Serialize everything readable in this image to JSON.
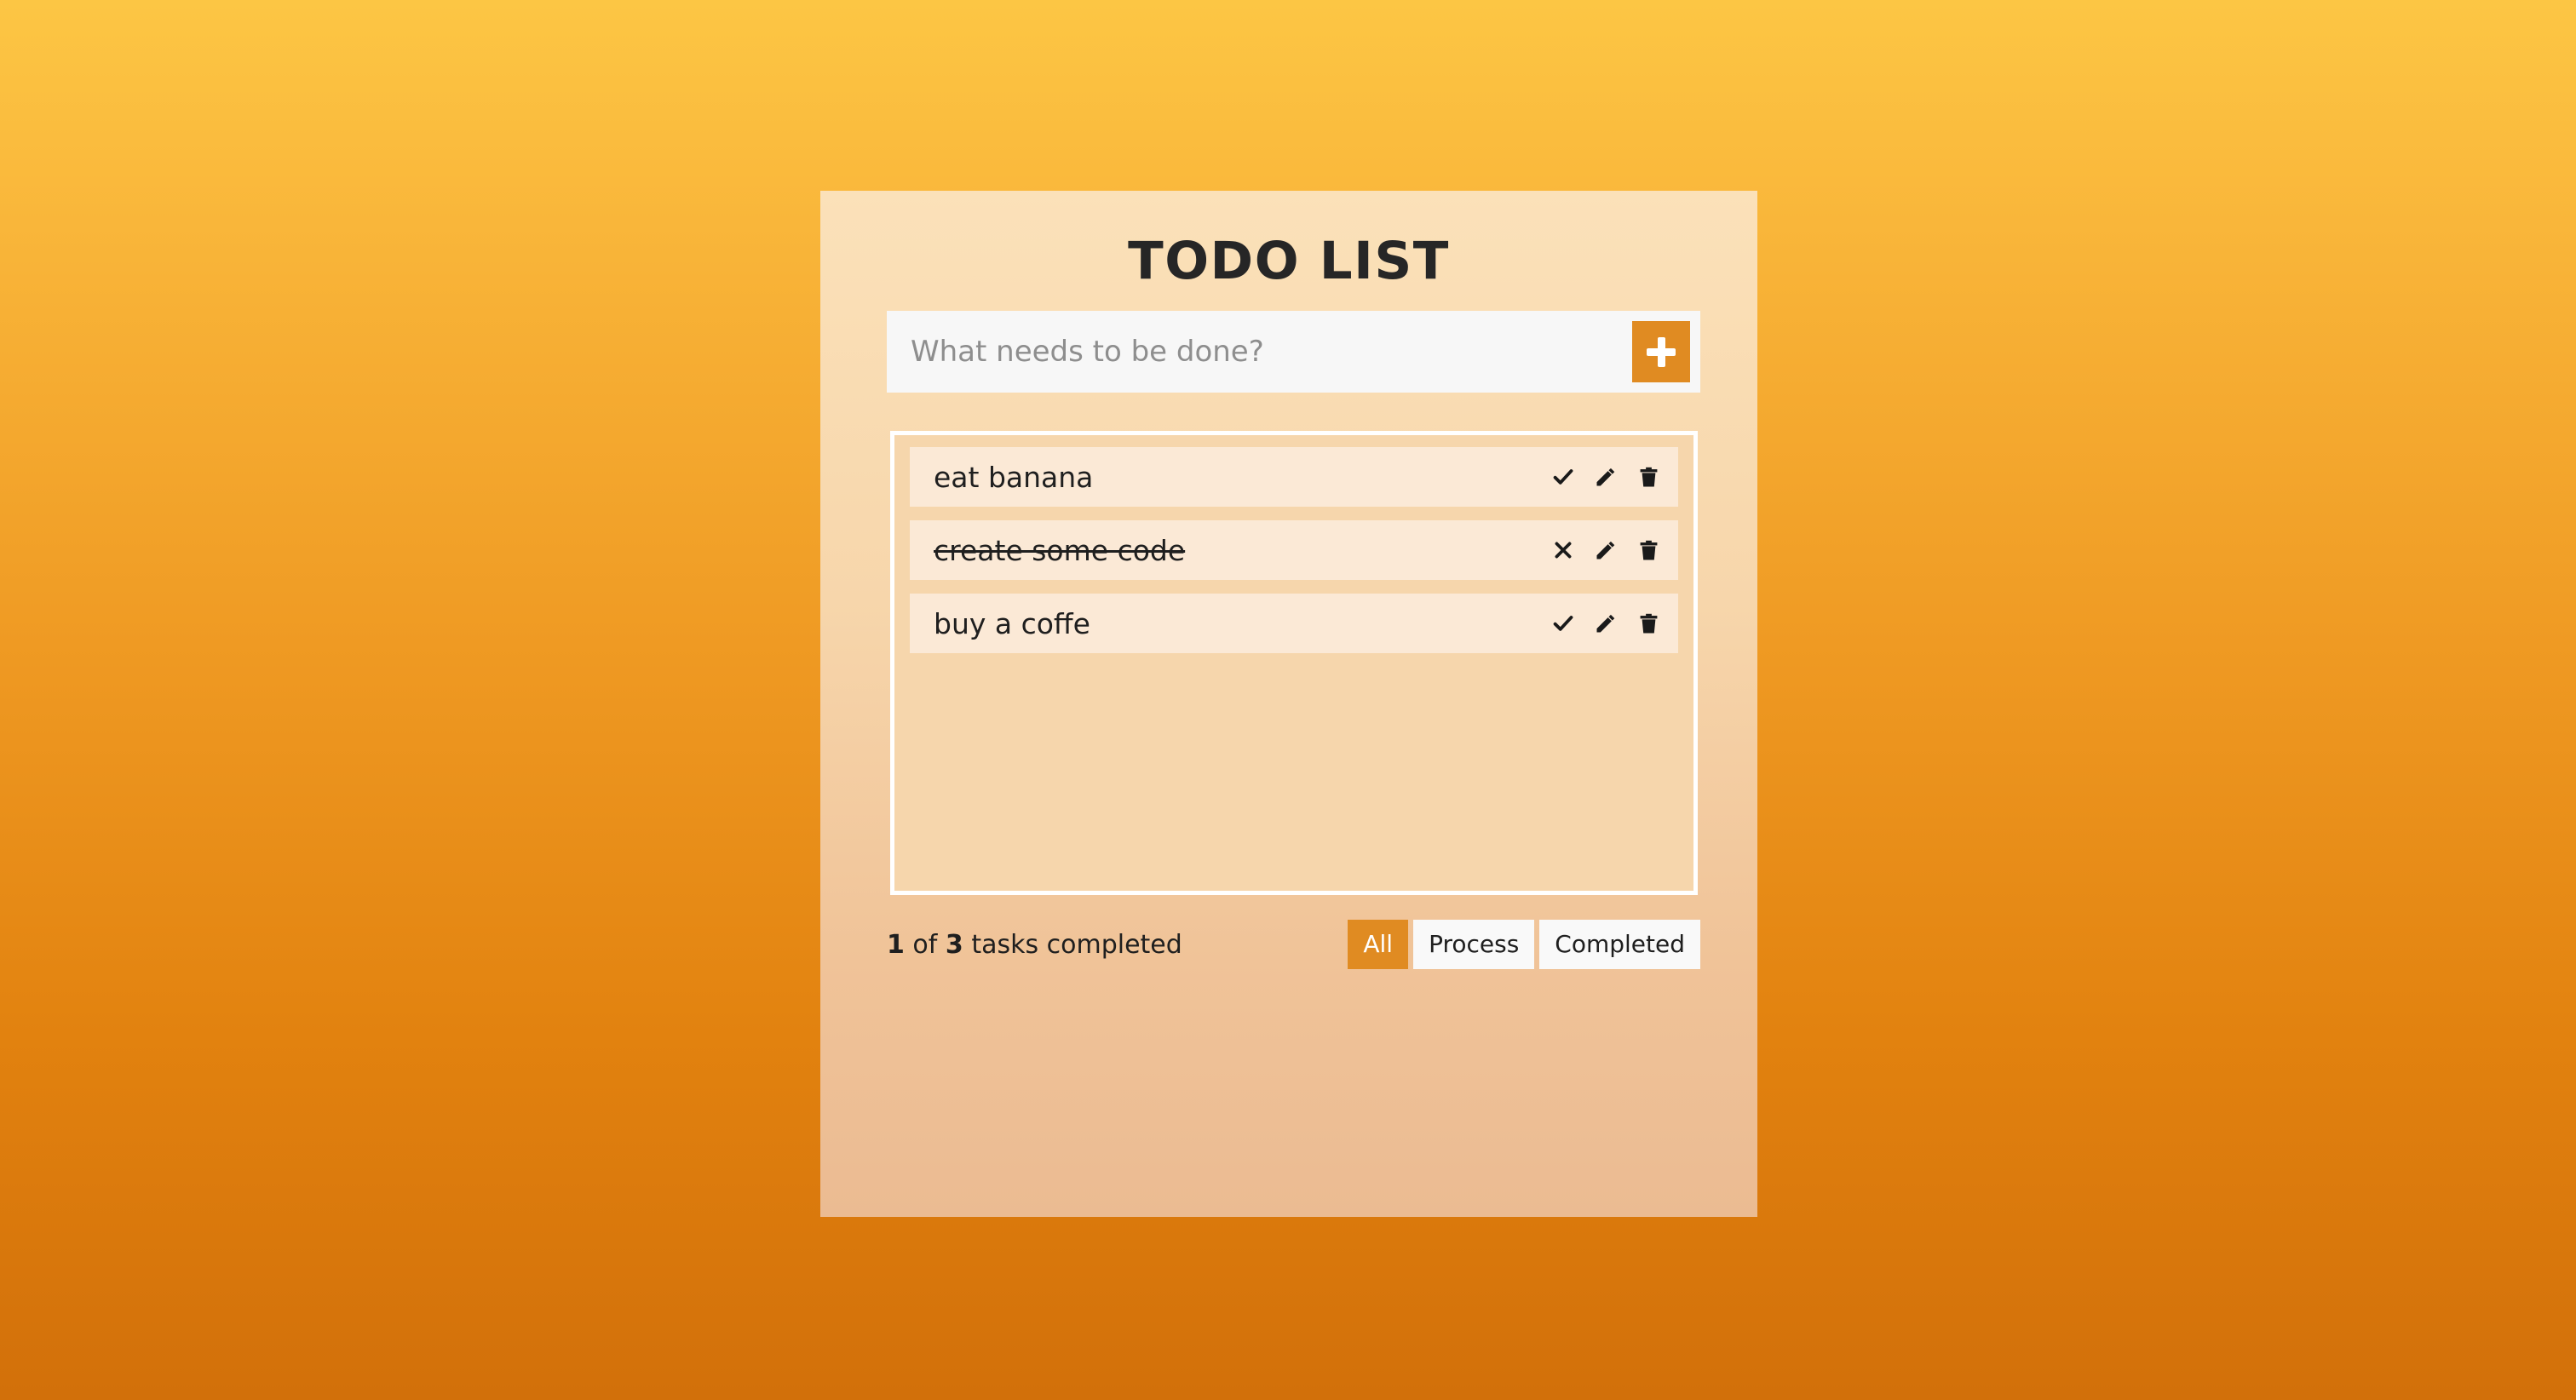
{
  "app": {
    "title": "TODO LIST",
    "accent_color": "#E08B22",
    "card_bg_top": "#FBE1B9",
    "card_bg_bottom": "#EBBB92",
    "page_bg_top": "#FCC644",
    "page_bg_bottom": "#D2700A",
    "task_bg": "#FBE9D6",
    "list_bg": "#F6D6AC"
  },
  "composer": {
    "placeholder": "What needs to be done?",
    "value": "",
    "add_icon": "plus-icon",
    "add_label": "+"
  },
  "tasks": [
    {
      "label": "eat banana",
      "completed": false,
      "toggle_icon": "check-icon",
      "edit_icon": "pencil-icon",
      "delete_icon": "trash-icon"
    },
    {
      "label": "create some code",
      "completed": true,
      "toggle_icon": "cross-icon",
      "edit_icon": "pencil-icon",
      "delete_icon": "trash-icon"
    },
    {
      "label": "buy a coffe",
      "completed": false,
      "toggle_icon": "check-icon",
      "edit_icon": "pencil-icon",
      "delete_icon": "trash-icon"
    }
  ],
  "footer": {
    "completed_count": "1",
    "of_text": "of",
    "total_count": "3",
    "suffix_text": "tasks completed",
    "filters": [
      {
        "label": "All",
        "active": true
      },
      {
        "label": "Process",
        "active": false
      },
      {
        "label": "Completed",
        "active": false
      }
    ]
  }
}
